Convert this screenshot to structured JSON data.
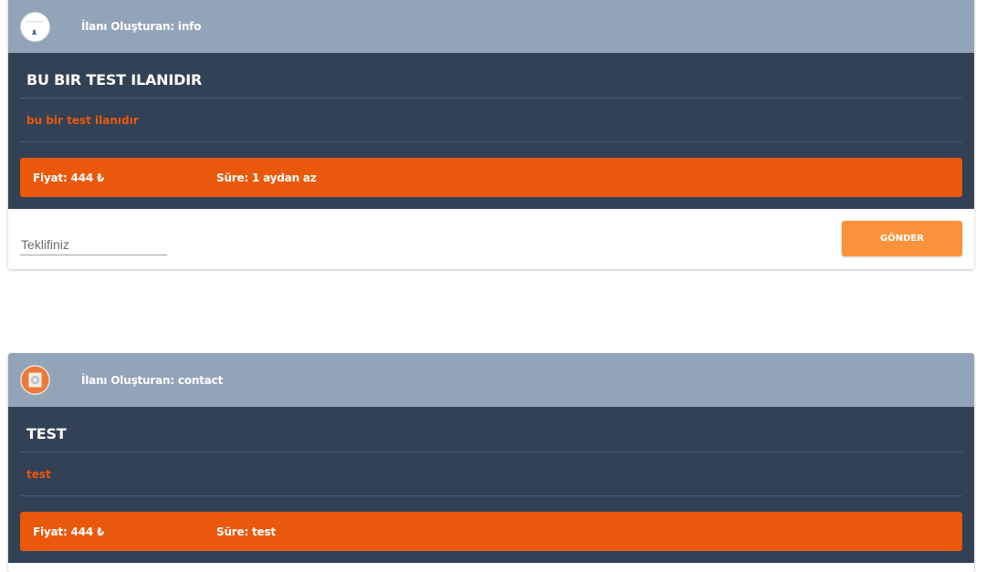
{
  "listings": [
    {
      "owner": "İlanı Oluşturan: info",
      "title": "BU BIR TEST ILANIDIR",
      "description": "bu bir test ilanıdır",
      "price": "Fiyat: 444 ₺",
      "duration": "Süre: 1 aydan az",
      "offer_placeholder": "Teklifiniz",
      "send_label": "GÖNDER"
    },
    {
      "owner": "İlanı Oluşturan: contact",
      "title": "TEST",
      "description": "test",
      "price": "Fiyat: 444 ₺",
      "duration": "Süre: test"
    }
  ],
  "colors": {
    "header": "#93a3b8",
    "body": "#334155",
    "accent": "#ea580c",
    "button": "#fb923c"
  },
  "icons": {
    "avatar_1": "user-avatar-icon",
    "avatar_2": "user-avatar-icon"
  }
}
